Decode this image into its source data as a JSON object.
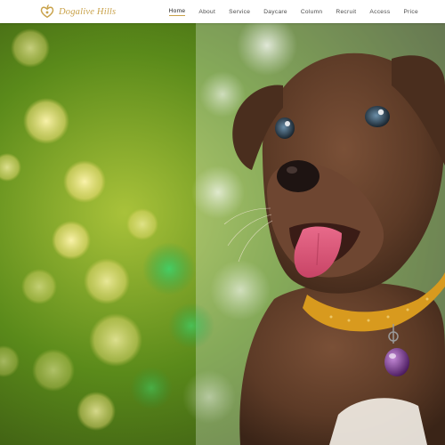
{
  "brand": {
    "name": "Dogalive Hills",
    "logo_icon": "heart-leaf-logo-icon",
    "accent_color": "#c9a24a"
  },
  "nav": {
    "items": [
      {
        "label": "Home",
        "active": true
      },
      {
        "label": "About",
        "active": false
      },
      {
        "label": "Service",
        "active": false
      },
      {
        "label": "Daycare",
        "active": false
      },
      {
        "label": "Column",
        "active": false
      },
      {
        "label": "Recruit",
        "active": false
      },
      {
        "label": "Access",
        "active": false
      },
      {
        "label": "Price",
        "active": false
      }
    ]
  },
  "hero": {
    "image": "puppy-photo",
    "colors": {
      "bokeh_green": "#5a8a1a",
      "fur_brown": "#5c3a26",
      "collar": "#d89a1e"
    }
  }
}
